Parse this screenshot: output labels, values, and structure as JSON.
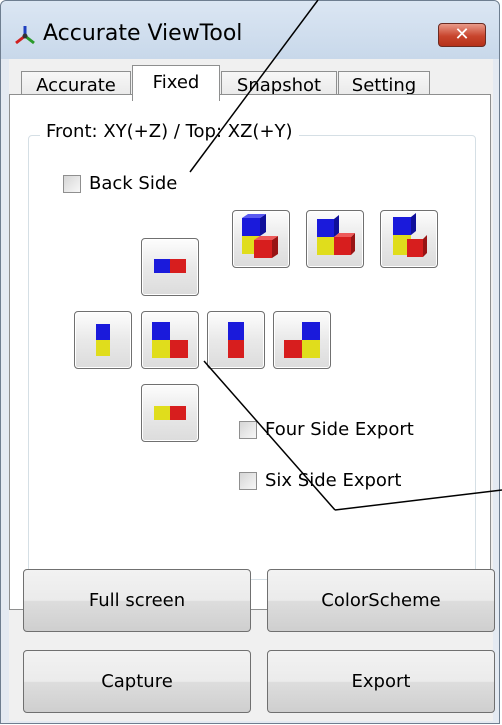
{
  "window": {
    "title": "Accurate ViewTool",
    "close_label": "✕"
  },
  "tabs": [
    {
      "label": "Accurate",
      "active": false
    },
    {
      "label": "Fixed",
      "active": true
    },
    {
      "label": "Snapshot",
      "active": false
    },
    {
      "label": "Setting",
      "active": false
    }
  ],
  "group": {
    "legend": "Front: XY(+Z) / Top: XZ(+Y)"
  },
  "checkboxes": {
    "back_side": {
      "label": "Back Side",
      "checked": false
    },
    "four_side_export": {
      "label": "Four Side Export",
      "checked": false
    },
    "six_side_export": {
      "label": "Six Side Export",
      "checked": false
    }
  },
  "buttons": {
    "full_screen": "Full screen",
    "color_scheme": "ColorScheme",
    "capture": "Capture",
    "export": "Export"
  },
  "colors": {
    "blue": "#1a1adb",
    "red": "#d71e1e",
    "yellow": "#e0dd1c",
    "close_red": "#c8452d"
  }
}
